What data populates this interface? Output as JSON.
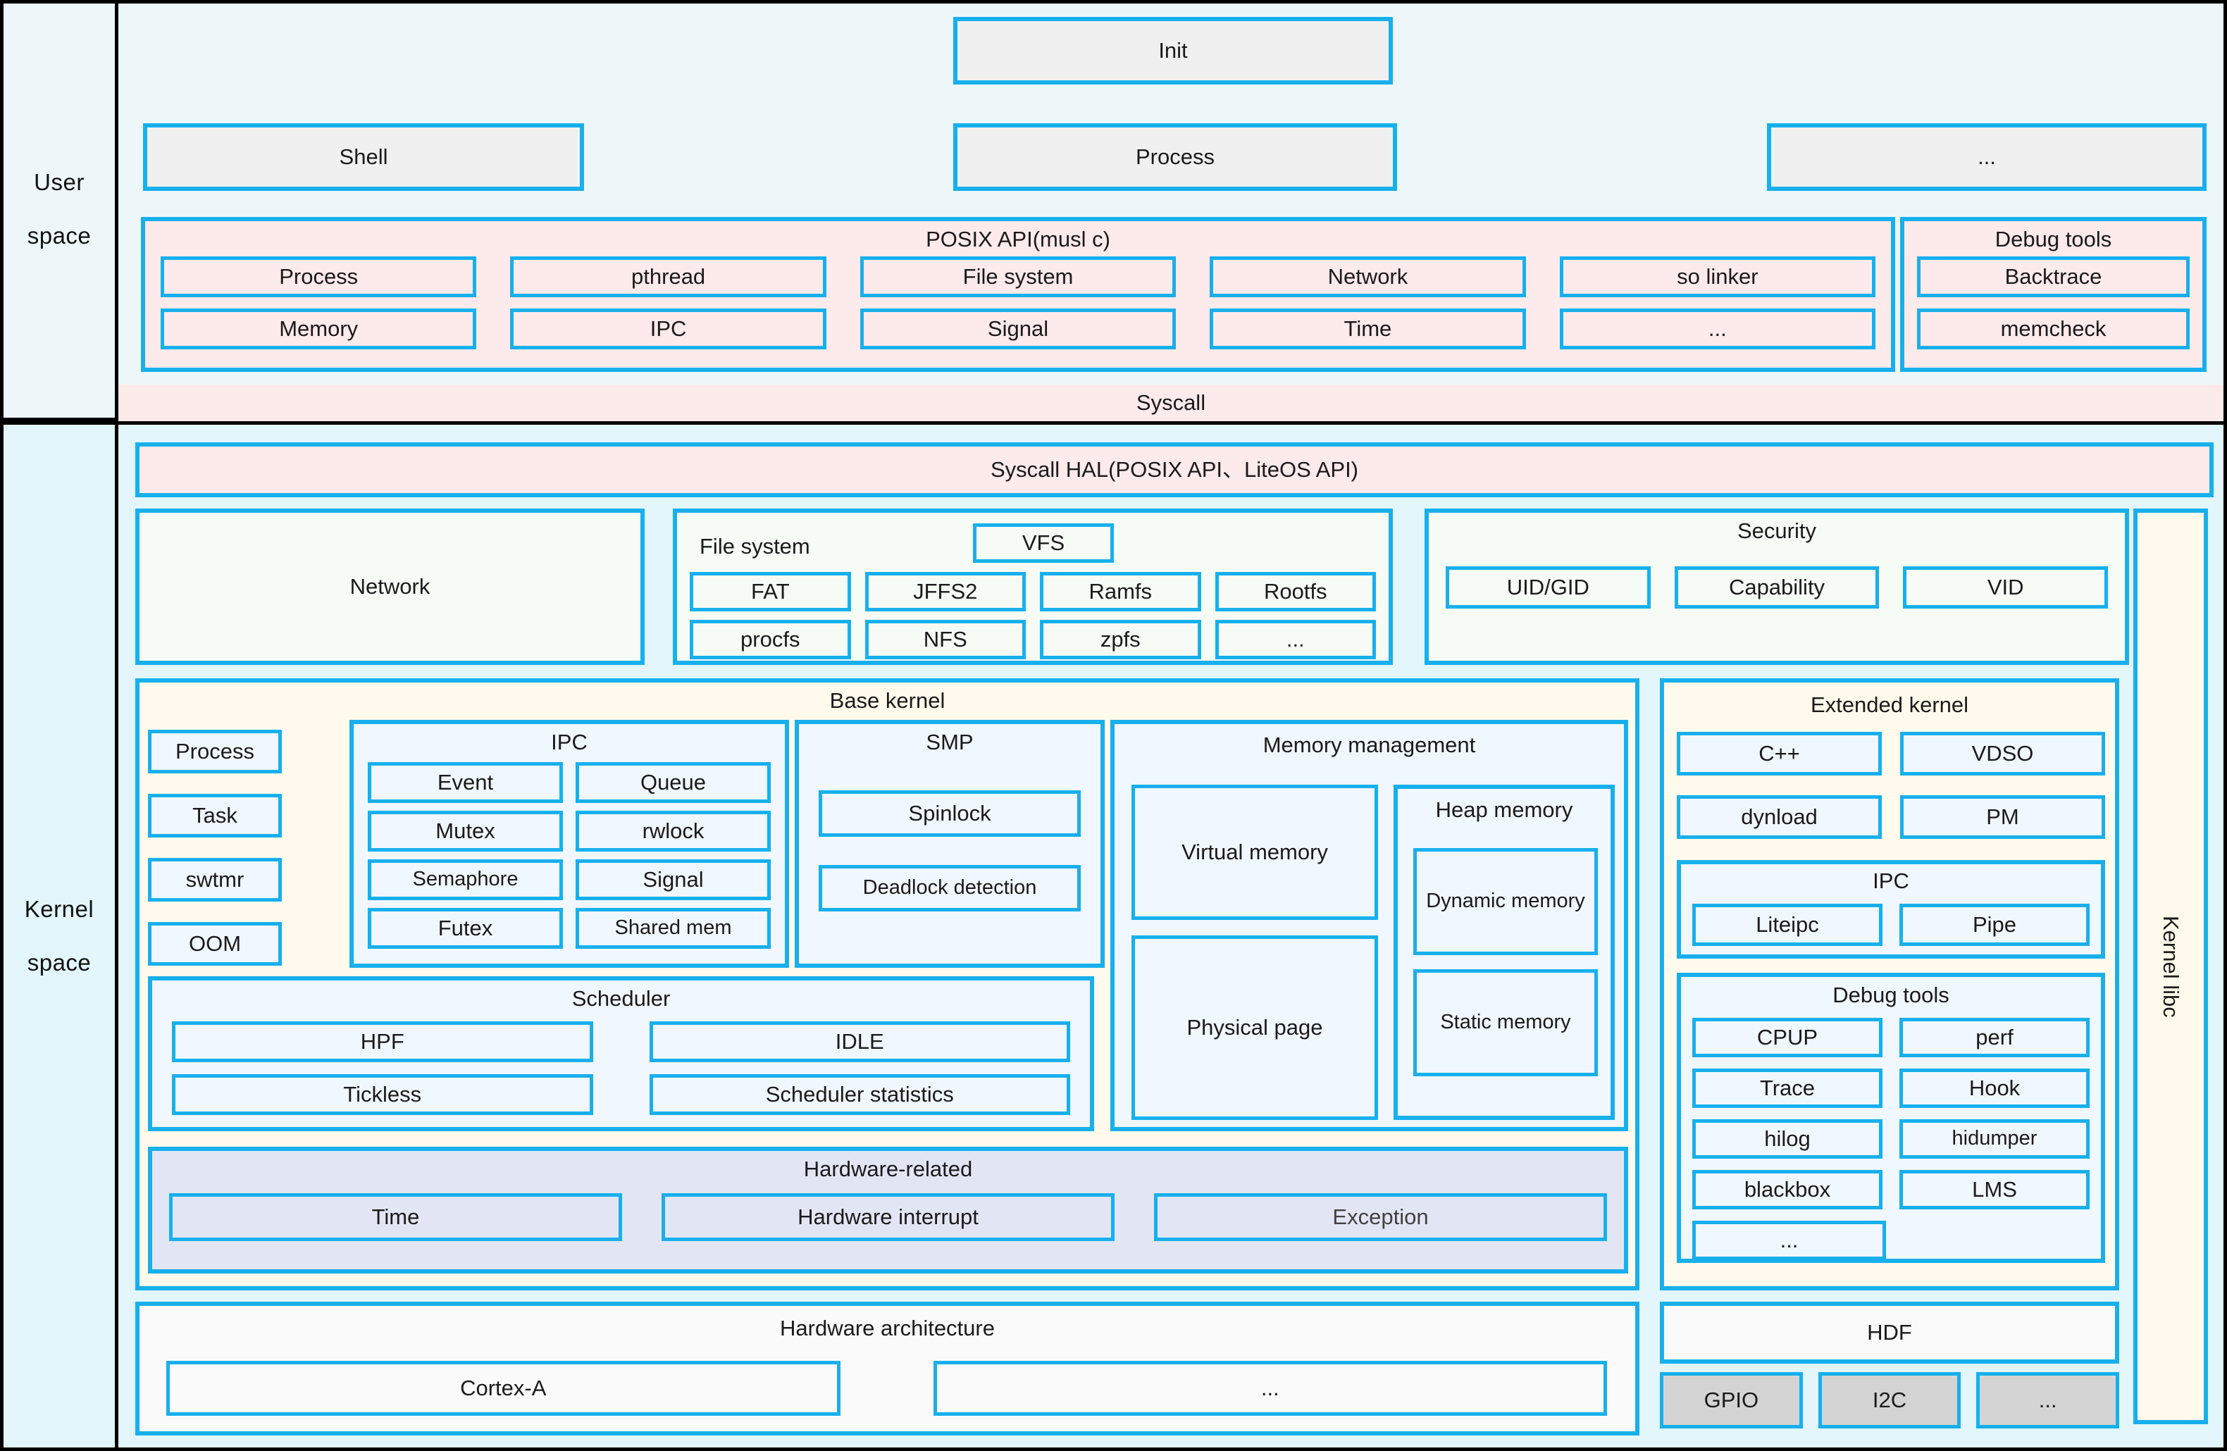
{
  "colors": {
    "accent_border": "#17b0ed",
    "frame": "#000000",
    "user_band_bg": "#edf7fa",
    "kernel_band_bg": "#e2f6fb",
    "pink_fill": "#fdeaea",
    "gray_fill": "#f0f0f0",
    "cream_fill": "#fffaeb",
    "lavender_fill": "#e2e6f4",
    "dark_gray_fill": "#d4d4d4"
  },
  "bands": {
    "user": {
      "line1": "User",
      "line2": "space"
    },
    "kernel": {
      "line1": "Kernel",
      "line2": "space"
    }
  },
  "user_space": {
    "init": "Init",
    "apps": [
      "Shell",
      "Process",
      "..."
    ],
    "posix": {
      "title": "POSIX API(musl c)",
      "row1": [
        "Process",
        "pthread",
        "File system",
        "Network",
        "so linker"
      ],
      "row2": [
        "Memory",
        "IPC",
        "Signal",
        "Time",
        "..."
      ]
    },
    "debug_tools": {
      "title": "Debug tools",
      "items": [
        "Backtrace",
        "memcheck"
      ]
    }
  },
  "syscall_bar": "Syscall",
  "kernel_space": {
    "syscall_hal": "Syscall HAL(POSIX API、LiteOS API)",
    "network": "Network",
    "file_system": {
      "title": "File system",
      "vfs": "VFS",
      "row1": [
        "FAT",
        "JFFS2",
        "Ramfs",
        "Rootfs"
      ],
      "row2": [
        "procfs",
        "NFS",
        "zpfs",
        "..."
      ]
    },
    "security": {
      "title": "Security",
      "items": [
        "UID/GID",
        "Capability",
        "VID"
      ]
    },
    "kernel_libc": "Kernel libc",
    "base_kernel": {
      "title": "Base kernel",
      "left_column": [
        "Process",
        "Task",
        "swtmr",
        "OOM"
      ],
      "ipc": {
        "title": "IPC",
        "items": [
          "Event",
          "Queue",
          "Mutex",
          "rwlock",
          "Semaphore",
          "Signal",
          "Futex",
          "Shared mem"
        ]
      },
      "smp": {
        "title": "SMP",
        "items": [
          "Spinlock",
          "Deadlock detection"
        ]
      },
      "memory_management": {
        "title": "Memory management",
        "left": [
          "Virtual memory",
          "Physical page"
        ],
        "heap": {
          "title": "Heap memory",
          "items": [
            "Dynamic memory",
            "Static memory"
          ]
        }
      },
      "scheduler": {
        "title": "Scheduler",
        "items": [
          "HPF",
          "IDLE",
          "Tickless",
          "Scheduler statistics"
        ]
      },
      "hardware_related": {
        "title": "Hardware-related",
        "items": [
          "Time",
          "Hardware interrupt",
          "Exception"
        ],
        "dim_item": "Exception"
      }
    },
    "extended_kernel": {
      "title": "Extended kernel",
      "top_items": [
        "C++",
        "VDSO",
        "dynload",
        "PM"
      ],
      "ipc": {
        "title": "IPC",
        "items": [
          "Liteipc",
          "Pipe"
        ]
      },
      "debug_tools": {
        "title": "Debug tools",
        "items": [
          "CPUP",
          "perf",
          "Trace",
          "Hook",
          "hilog",
          "hidumper",
          "blackbox",
          "LMS",
          "..."
        ]
      }
    },
    "hardware_architecture": {
      "title": "Hardware architecture",
      "items": [
        "Cortex-A",
        "..."
      ]
    },
    "hdf": {
      "title": "HDF",
      "items": [
        "GPIO",
        "I2C",
        "..."
      ]
    }
  }
}
